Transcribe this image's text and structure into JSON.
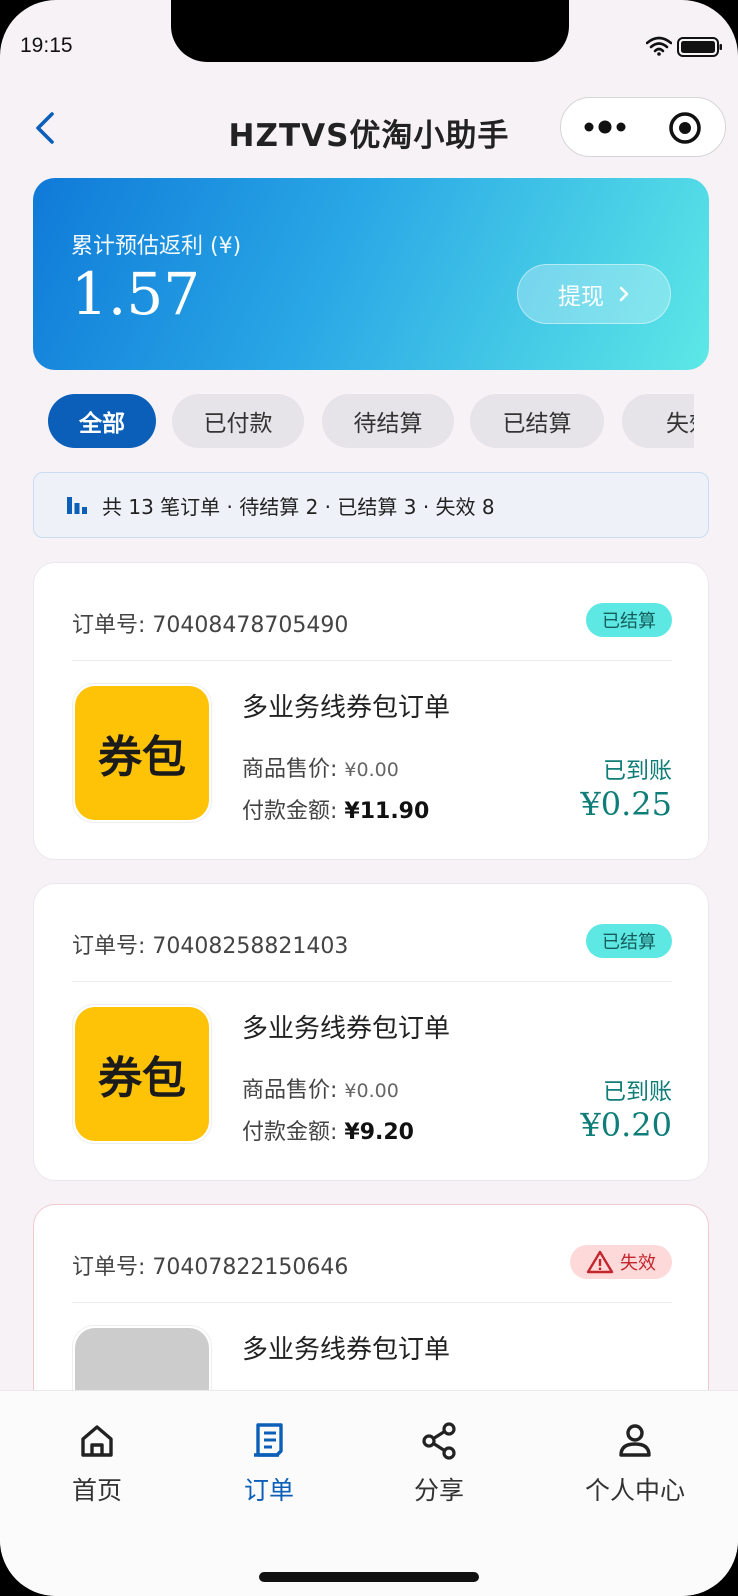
{
  "status": {
    "time": "19:15"
  },
  "header": {
    "title": "HZTVS优淘小助手"
  },
  "rebate": {
    "label": "累计预估返利 (¥)",
    "value": "1.57",
    "withdraw_label": "提现"
  },
  "filters": [
    "全部",
    "已付款",
    "待结算",
    "已结算",
    "失效"
  ],
  "summary": {
    "text": "共 13 笔订单 · 待结算 2 · 已结算 3 · 失效 8"
  },
  "orders": [
    {
      "order_no": "订单号: 70408478705490",
      "status": "已结算",
      "thumb": "券包",
      "title": "多业务线券包订单",
      "price_label": "商品售价: ",
      "price": "¥0.00",
      "paid_label": "付款金额: ",
      "paid": "¥11.90",
      "arrival": "已到账",
      "rebate": "¥0.25"
    },
    {
      "order_no": "订单号: 70408258821403",
      "status": "已结算",
      "thumb": "券包",
      "title": "多业务线券包订单",
      "price_label": "商品售价: ",
      "price": "¥0.00",
      "paid_label": "付款金额: ",
      "paid": "¥9.20",
      "arrival": "已到账",
      "rebate": "¥0.20"
    },
    {
      "order_no": "订单号: 70407822150646",
      "status": "失效",
      "title": "多业务线券包订单"
    }
  ],
  "tabs": [
    {
      "label": "首页",
      "icon": "home-icon"
    },
    {
      "label": "订单",
      "icon": "order-icon"
    },
    {
      "label": "分享",
      "icon": "share-icon"
    },
    {
      "label": "个人中心",
      "icon": "user-icon"
    }
  ],
  "colors": {
    "primary": "#0b5fb8",
    "settled_bg": "#5de8e4",
    "fail_bg": "#fdd9d9",
    "rebate_text": "#0f7d78"
  }
}
